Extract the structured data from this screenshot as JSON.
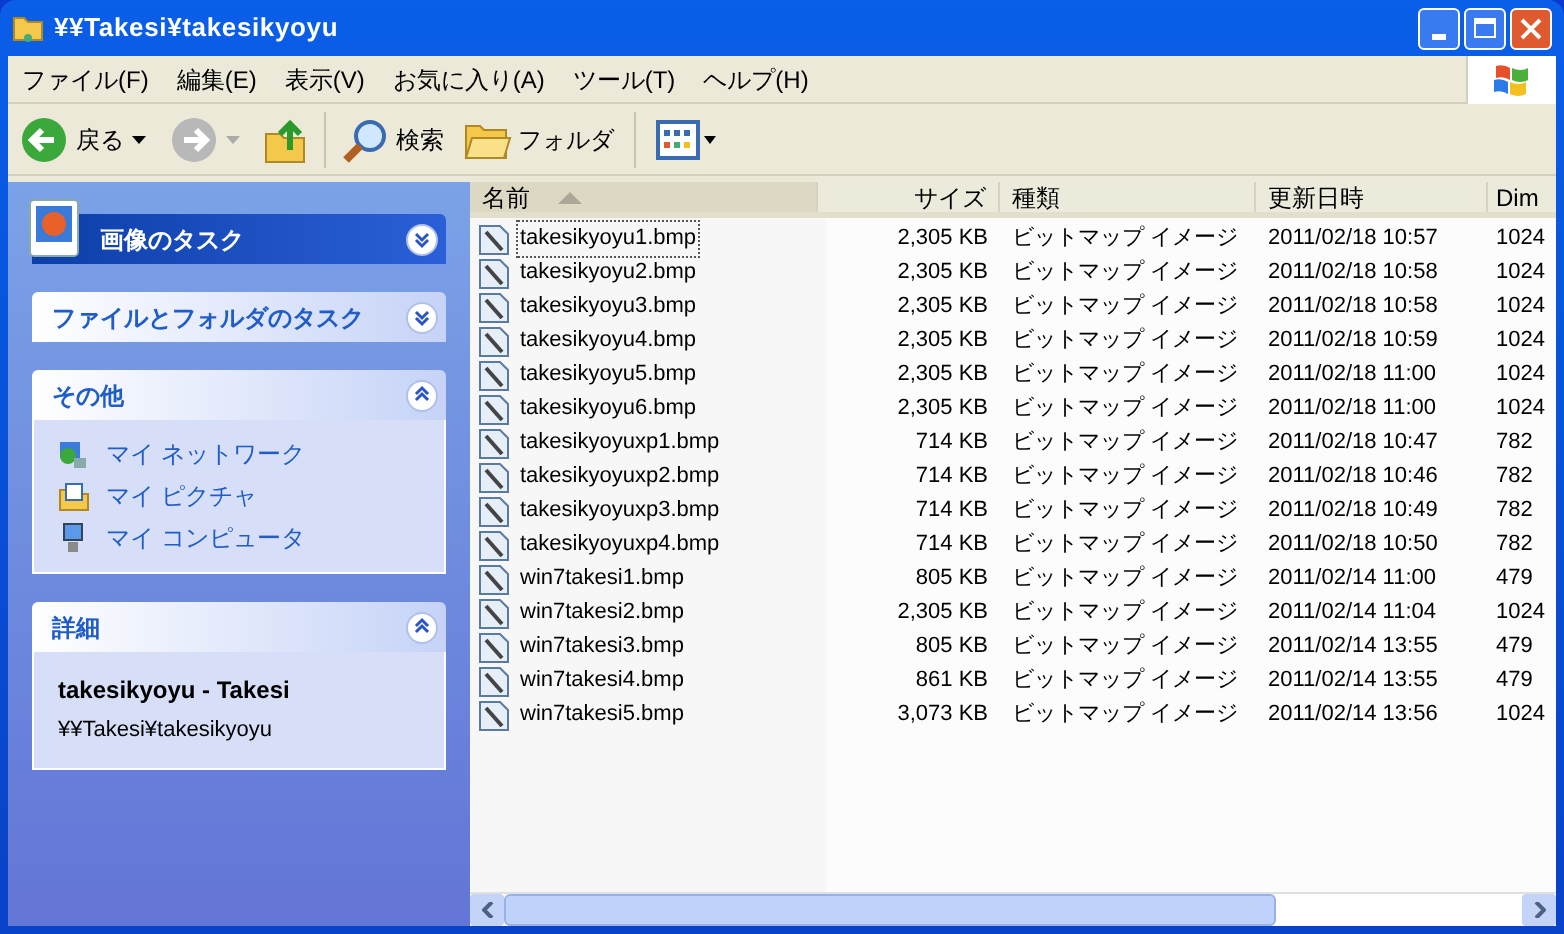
{
  "window": {
    "title": "¥¥Takesi¥takesikyoyu"
  },
  "menu": [
    "ファイル(F)",
    "編集(E)",
    "表示(V)",
    "お気に入り(A)",
    "ツール(T)",
    "ヘルプ(H)"
  ],
  "toolbar": {
    "back": "戻る",
    "search": "検索",
    "folders": "フォルダ"
  },
  "task_panes": [
    {
      "title": "画像のタスク",
      "kind": "special",
      "expanded": false
    },
    {
      "title": "ファイルとフォルダのタスク",
      "kind": "normal",
      "expanded": false
    },
    {
      "title": "その他",
      "kind": "normal",
      "expanded": true,
      "links": [
        {
          "label": "マイ ネットワーク",
          "kind": "network"
        },
        {
          "label": "マイ ピクチャ",
          "kind": "pictures"
        },
        {
          "label": "マイ コンピュータ",
          "kind": "computer"
        }
      ]
    },
    {
      "title": "詳細",
      "kind": "normal",
      "expanded": true,
      "detail_name": "takesikyoyu - Takesi",
      "detail_path": "¥¥Takesi¥takesikyoyu"
    }
  ],
  "columns": [
    {
      "label": "名前",
      "sorted": true
    },
    {
      "label": "サイズ",
      "sorted": false
    },
    {
      "label": "種類",
      "sorted": false
    },
    {
      "label": "更新日時",
      "sorted": false
    },
    {
      "label": "Dim",
      "sorted": false
    }
  ],
  "rows": [
    {
      "cells": [
        "takesikyoyu1.bmp",
        "2,305 KB",
        "ビットマップ イメージ",
        "2011/02/18 10:57",
        "1024"
      ],
      "focused": true
    },
    {
      "cells": [
        "takesikyoyu2.bmp",
        "2,305 KB",
        "ビットマップ イメージ",
        "2011/02/18 10:58",
        "1024"
      ],
      "focused": false
    },
    {
      "cells": [
        "takesikyoyu3.bmp",
        "2,305 KB",
        "ビットマップ イメージ",
        "2011/02/18 10:58",
        "1024"
      ],
      "focused": false
    },
    {
      "cells": [
        "takesikyoyu4.bmp",
        "2,305 KB",
        "ビットマップ イメージ",
        "2011/02/18 10:59",
        "1024"
      ],
      "focused": false
    },
    {
      "cells": [
        "takesikyoyu5.bmp",
        "2,305 KB",
        "ビットマップ イメージ",
        "2011/02/18 11:00",
        "1024"
      ],
      "focused": false
    },
    {
      "cells": [
        "takesikyoyu6.bmp",
        "2,305 KB",
        "ビットマップ イメージ",
        "2011/02/18 11:00",
        "1024"
      ],
      "focused": false
    },
    {
      "cells": [
        "takesikyoyuxp1.bmp",
        "714 KB",
        "ビットマップ イメージ",
        "2011/02/18 10:47",
        "782"
      ],
      "focused": false
    },
    {
      "cells": [
        "takesikyoyuxp2.bmp",
        "714 KB",
        "ビットマップ イメージ",
        "2011/02/18 10:46",
        "782"
      ],
      "focused": false
    },
    {
      "cells": [
        "takesikyoyuxp3.bmp",
        "714 KB",
        "ビットマップ イメージ",
        "2011/02/18 10:49",
        "782"
      ],
      "focused": false
    },
    {
      "cells": [
        "takesikyoyuxp4.bmp",
        "714 KB",
        "ビットマップ イメージ",
        "2011/02/18 10:50",
        "782"
      ],
      "focused": false
    },
    {
      "cells": [
        "win7takesi1.bmp",
        "805 KB",
        "ビットマップ イメージ",
        "2011/02/14 11:00",
        "479"
      ],
      "focused": false
    },
    {
      "cells": [
        "win7takesi2.bmp",
        "2,305 KB",
        "ビットマップ イメージ",
        "2011/02/14 11:04",
        "1024"
      ],
      "focused": false
    },
    {
      "cells": [
        "win7takesi3.bmp",
        "805 KB",
        "ビットマップ イメージ",
        "2011/02/14 13:55",
        "479"
      ],
      "focused": false
    },
    {
      "cells": [
        "win7takesi4.bmp",
        "861 KB",
        "ビットマップ イメージ",
        "2011/02/14 13:55",
        "479"
      ],
      "focused": false
    },
    {
      "cells": [
        "win7takesi5.bmp",
        "3,073 KB",
        "ビットマップ イメージ",
        "2011/02/14 13:56",
        "1024"
      ],
      "focused": false
    }
  ]
}
